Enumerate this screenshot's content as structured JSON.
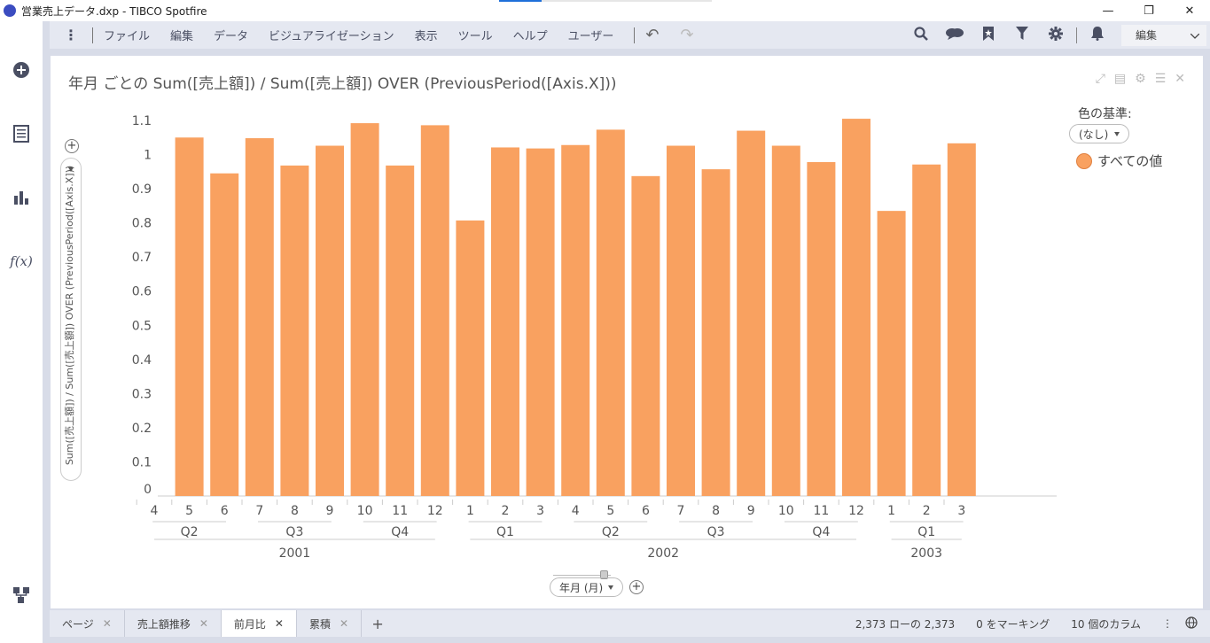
{
  "window": {
    "title": "営業売上データ.dxp - TIBCO Spotfire",
    "controls": [
      "—",
      "❐",
      "✕"
    ]
  },
  "menu": {
    "items": [
      "ファイル",
      "編集",
      "データ",
      "ビジュアライゼーション",
      "表示",
      "ツール",
      "ヘルプ",
      "ユーザー"
    ],
    "edit_button": "編集"
  },
  "sidebar": {
    "icons": [
      "add-icon",
      "data-table-icon",
      "visualization-icon",
      "function-icon",
      "hierarchy-icon"
    ],
    "fx_label": "f(x)"
  },
  "visualization": {
    "title": "年月 ごとの Sum([売上額]) / Sum([売上額]) OVER (PreviousPeriod([Axis.X]))",
    "y_axis_label": "Sum([売上額]) / Sum([売上額]) OVER (PreviousPeriod([Axis.X]))",
    "x_axis_selector": "年月 (月)"
  },
  "legend": {
    "title": "色の基準:",
    "color_by": "(なし)",
    "item_label": "すべての値",
    "item_color": "#f9a160"
  },
  "chart_data": {
    "type": "bar",
    "color": "#f9a160",
    "ylim": [
      0,
      1.15
    ],
    "yticks": [
      "0",
      "0.1",
      "0.2",
      "0.3",
      "0.4",
      "0.5",
      "0.6",
      "0.7",
      "0.8",
      "0.9",
      "1",
      "1.1"
    ],
    "categories": [
      "4",
      "5",
      "6",
      "7",
      "8",
      "9",
      "10",
      "11",
      "12",
      "1",
      "2",
      "3",
      "4",
      "5",
      "6",
      "7",
      "8",
      "9",
      "10",
      "11",
      "12",
      "1",
      "2",
      "3"
    ],
    "values": [
      null,
      1.05,
      0.945,
      1.048,
      0.968,
      1.026,
      1.092,
      0.968,
      1.086,
      0.807,
      1.021,
      1.018,
      1.028,
      1.073,
      0.937,
      1.026,
      0.957,
      1.07,
      1.026,
      0.978,
      1.105,
      0.835,
      0.971,
      1.033
    ],
    "quarters": [
      {
        "label": "Q2",
        "from": 0,
        "to": 2
      },
      {
        "label": "Q3",
        "from": 3,
        "to": 5
      },
      {
        "label": "Q4",
        "from": 6,
        "to": 8
      },
      {
        "label": "Q1",
        "from": 9,
        "to": 11
      },
      {
        "label": "Q2",
        "from": 12,
        "to": 14
      },
      {
        "label": "Q3",
        "from": 15,
        "to": 17
      },
      {
        "label": "Q4",
        "from": 18,
        "to": 20
      },
      {
        "label": "Q1",
        "from": 21,
        "to": 23
      }
    ],
    "years": [
      {
        "label": "2001",
        "from": 0,
        "to": 8
      },
      {
        "label": "2002",
        "from": 9,
        "to": 20
      },
      {
        "label": "2003",
        "from": 21,
        "to": 23
      }
    ]
  },
  "pages": [
    {
      "label": "ページ",
      "active": false
    },
    {
      "label": "売上額推移",
      "active": false
    },
    {
      "label": "前月比",
      "active": true
    },
    {
      "label": "累積",
      "active": false
    }
  ],
  "status": {
    "rows": "2,373 ローの 2,373",
    "marked": "0 をマーキング",
    "columns": "10 個のカラム"
  }
}
